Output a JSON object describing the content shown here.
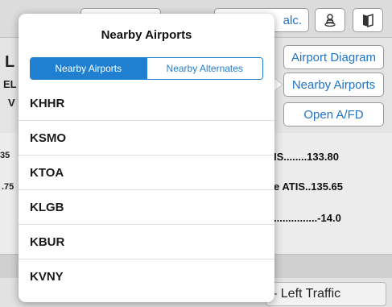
{
  "popover": {
    "title": "Nearby Airports",
    "segments": [
      {
        "label": "Nearby Airports",
        "active": true
      },
      {
        "label": "Nearby Alternates",
        "active": false
      }
    ],
    "airports": [
      "KHHR",
      "KSMO",
      "KTOA",
      "KLGB",
      "KBUR",
      "KVNY"
    ]
  },
  "background": {
    "top_button_partial": "alc.",
    "actions": [
      "Airport Diagram",
      "Nearby Airports",
      "Open A/FD"
    ],
    "frequencies": [
      {
        "label": "IS........133.80"
      },
      {
        "label": "e ATIS..135.65"
      },
      {
        "label": "...............-14.0"
      }
    ],
    "left_fragments": [
      "L",
      "EL",
      "V",
      "35",
      ".75"
    ],
    "traffic_text": "- Left Traffic"
  },
  "colors": {
    "accent": "#1f7fd1"
  }
}
